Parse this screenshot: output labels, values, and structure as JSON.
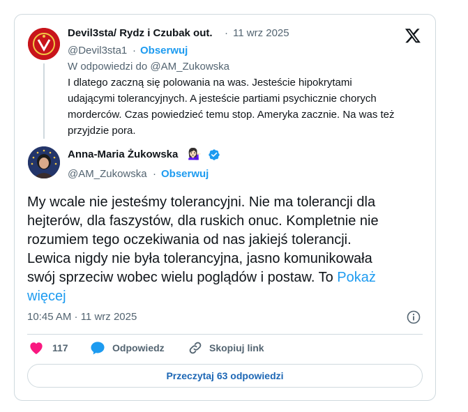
{
  "reply_tweet": {
    "author_name": "Devil3sta/ Rydz i Czubak out.",
    "separator": "·",
    "date": "11 wrz 2025",
    "handle": "@Devil3sta1",
    "follow_label": "Obserwuj",
    "in_reply_to": "W odpowiedzi do @AM_Zukowska",
    "text_lines": [
      "I dlatego zaczną się polowania na was. Jesteście hipokrytami",
      "udającymi tolerancyjnych. A jesteście partiami psychicznie chorych",
      "morderców. Czas powiedzieć temu stop. Ameryka zacznie. Na was też",
      "przyjdzie pora."
    ]
  },
  "main_tweet": {
    "author_name": "Anna-Maria Żukowska",
    "emoji": "💁🏻‍♀️",
    "verified_icon": "verified-badge-icon",
    "handle": "@AM_Zukowska",
    "separator": "·",
    "follow_label": "Obserwuj",
    "text_lines": [
      "My wcale nie jesteśmy tolerancyjni. Nie ma tolerancji dla",
      "hejterów, dla faszystów, dla ruskich onuc. Kompletnie nie",
      "rozumiem tego oczekiwania od nas jakiejś tolerancji.",
      "Lewica nigdy nie była tolerancyjna, jasno komunikowała",
      "swój sprzeciw wobec wielu poglądów i postaw. To "
    ],
    "show_more": "Pokaż",
    "show_more_line2": "więcej",
    "timestamp": "10:45 AM · 11 wrz 2025"
  },
  "actions": {
    "like_count": "117",
    "reply_label": "Odpowiedz",
    "copy_label": "Skopiuj link"
  },
  "read_replies_label": "Przeczytaj 63 odpowiedzi",
  "colors": {
    "accent": "#1d9bf0",
    "like": "#f91880",
    "text": "#0f1419",
    "muted": "#536471",
    "border": "#cfd9de"
  }
}
